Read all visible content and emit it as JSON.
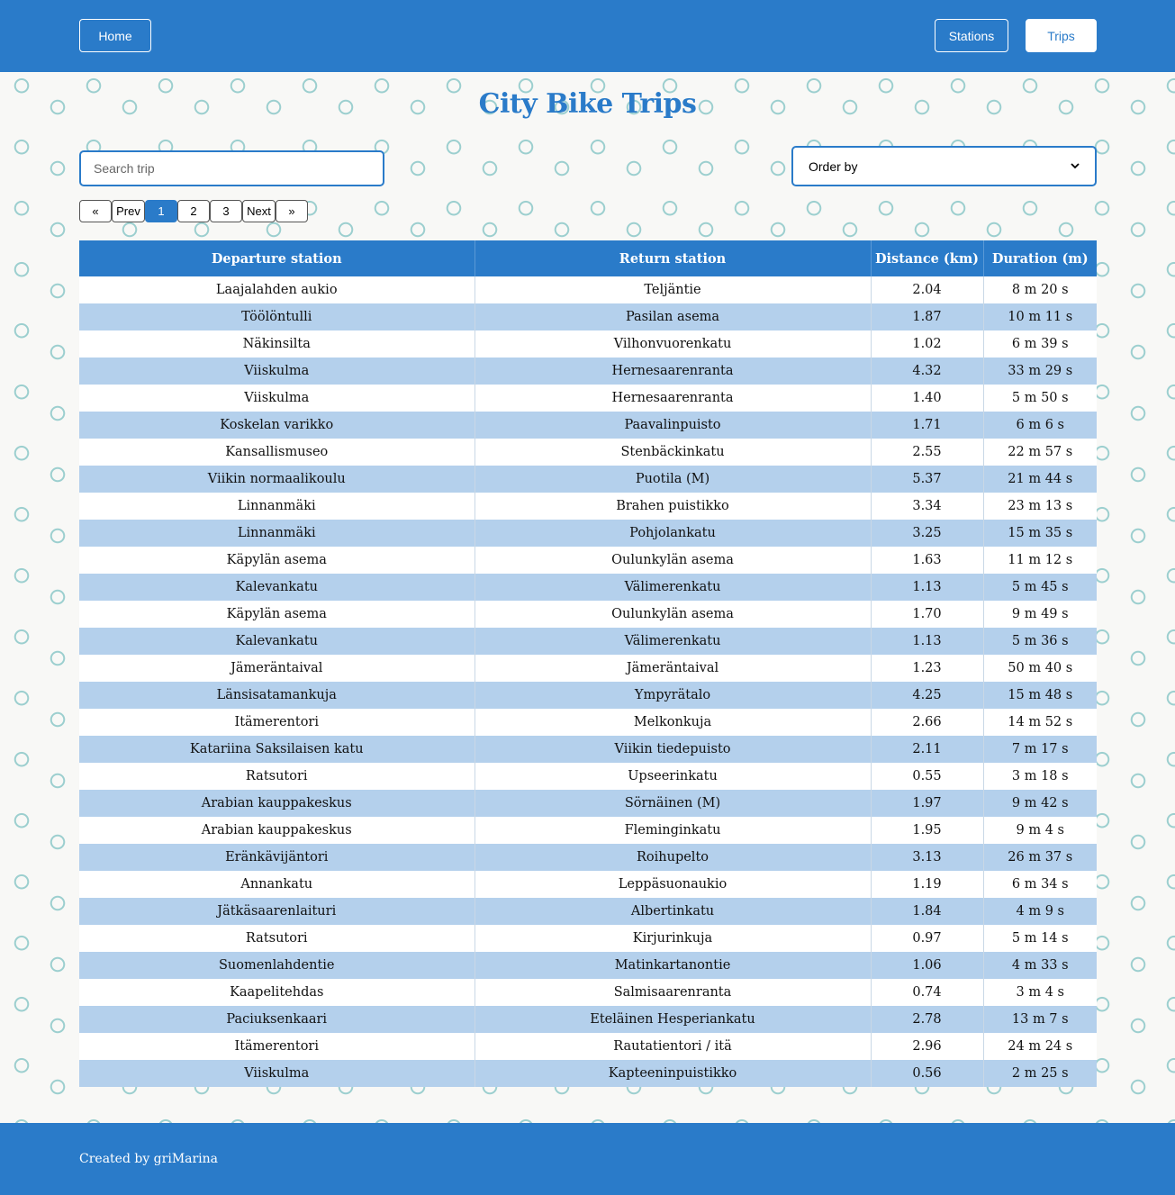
{
  "nav": {
    "home": "Home",
    "stations": "Stations",
    "trips": "Trips"
  },
  "page": {
    "title": "City Bike Trips"
  },
  "search": {
    "placeholder": "Search trip"
  },
  "order": {
    "selected": "Order by"
  },
  "pagination": {
    "first": "«",
    "prev": "Prev",
    "pages": [
      "1",
      "2",
      "3"
    ],
    "active_page": "1",
    "next": "Next",
    "last": "»"
  },
  "table": {
    "headers": [
      "Departure station",
      "Return station",
      "Distance (km)",
      "Duration (m)"
    ],
    "rows": [
      [
        "Laajalahden aukio",
        "Teljäntie",
        "2.04",
        "8 m 20 s"
      ],
      [
        "Töölöntulli",
        "Pasilan asema",
        "1.87",
        "10 m 11 s"
      ],
      [
        "Näkinsilta",
        "Vilhonvuorenkatu",
        "1.02",
        "6 m 39 s"
      ],
      [
        "Viiskulma",
        "Hernesaarenranta",
        "4.32",
        "33 m 29 s"
      ],
      [
        "Viiskulma",
        "Hernesaarenranta",
        "1.40",
        "5 m 50 s"
      ],
      [
        "Koskelan varikko",
        "Paavalinpuisto",
        "1.71",
        "6 m 6 s"
      ],
      [
        "Kansallismuseo",
        "Stenbäckinkatu",
        "2.55",
        "22 m 57 s"
      ],
      [
        "Viikin normaalikoulu",
        "Puotila (M)",
        "5.37",
        "21 m 44 s"
      ],
      [
        "Linnanmäki",
        "Brahen puistikko",
        "3.34",
        "23 m 13 s"
      ],
      [
        "Linnanmäki",
        "Pohjolankatu",
        "3.25",
        "15 m 35 s"
      ],
      [
        "Käpylän asema",
        "Oulunkylän asema",
        "1.63",
        "11 m 12 s"
      ],
      [
        "Kalevankatu",
        "Välimerenkatu",
        "1.13",
        "5 m 45 s"
      ],
      [
        "Käpylän asema",
        "Oulunkylän asema",
        "1.70",
        "9 m 49 s"
      ],
      [
        "Kalevankatu",
        "Välimerenkatu",
        "1.13",
        "5 m 36 s"
      ],
      [
        "Jämeräntaival",
        "Jämeräntaival",
        "1.23",
        "50 m 40 s"
      ],
      [
        "Länsisatamankuja",
        "Ympyrätalo",
        "4.25",
        "15 m 48 s"
      ],
      [
        "Itämerentori",
        "Melkonkuja",
        "2.66",
        "14 m 52 s"
      ],
      [
        "Katariina Saksilaisen katu",
        "Viikin tiedepuisto",
        "2.11",
        "7 m 17 s"
      ],
      [
        "Ratsutori",
        "Upseerinkatu",
        "0.55",
        "3 m 18 s"
      ],
      [
        "Arabian kauppakeskus",
        "Sörnäinen (M)",
        "1.97",
        "9 m 42 s"
      ],
      [
        "Arabian kauppakeskus",
        "Fleminginkatu",
        "1.95",
        "9 m 4 s"
      ],
      [
        "Eränkävijäntori",
        "Roihupelto",
        "3.13",
        "26 m 37 s"
      ],
      [
        "Annankatu",
        "Leppäsuonaukio",
        "1.19",
        "6 m 34 s"
      ],
      [
        "Jätkäsaarenlaituri",
        "Albertinkatu",
        "1.84",
        "4 m 9 s"
      ],
      [
        "Ratsutori",
        "Kirjurinkuja",
        "0.97",
        "5 m 14 s"
      ],
      [
        "Suomenlahdentie",
        "Matinkartanontie",
        "1.06",
        "4 m 33 s"
      ],
      [
        "Kaapelitehdas",
        "Salmisaarenranta",
        "0.74",
        "3 m 4 s"
      ],
      [
        "Paciuksenkaari",
        "Eteläinen Hesperiankatu",
        "2.78",
        "13 m 7 s"
      ],
      [
        "Itämerentori",
        "Rautatientori / itä",
        "2.96",
        "24 m 24 s"
      ],
      [
        "Viiskulma",
        "Kapteeninpuistikko",
        "0.56",
        "2 m 25 s"
      ]
    ]
  },
  "footer": {
    "credit": "Created by griMarina",
    "icon": "github-icon"
  },
  "colors": {
    "primary": "#2a7bc9",
    "row_alt": "#b4d0ec",
    "background": "#f8f8f6"
  }
}
